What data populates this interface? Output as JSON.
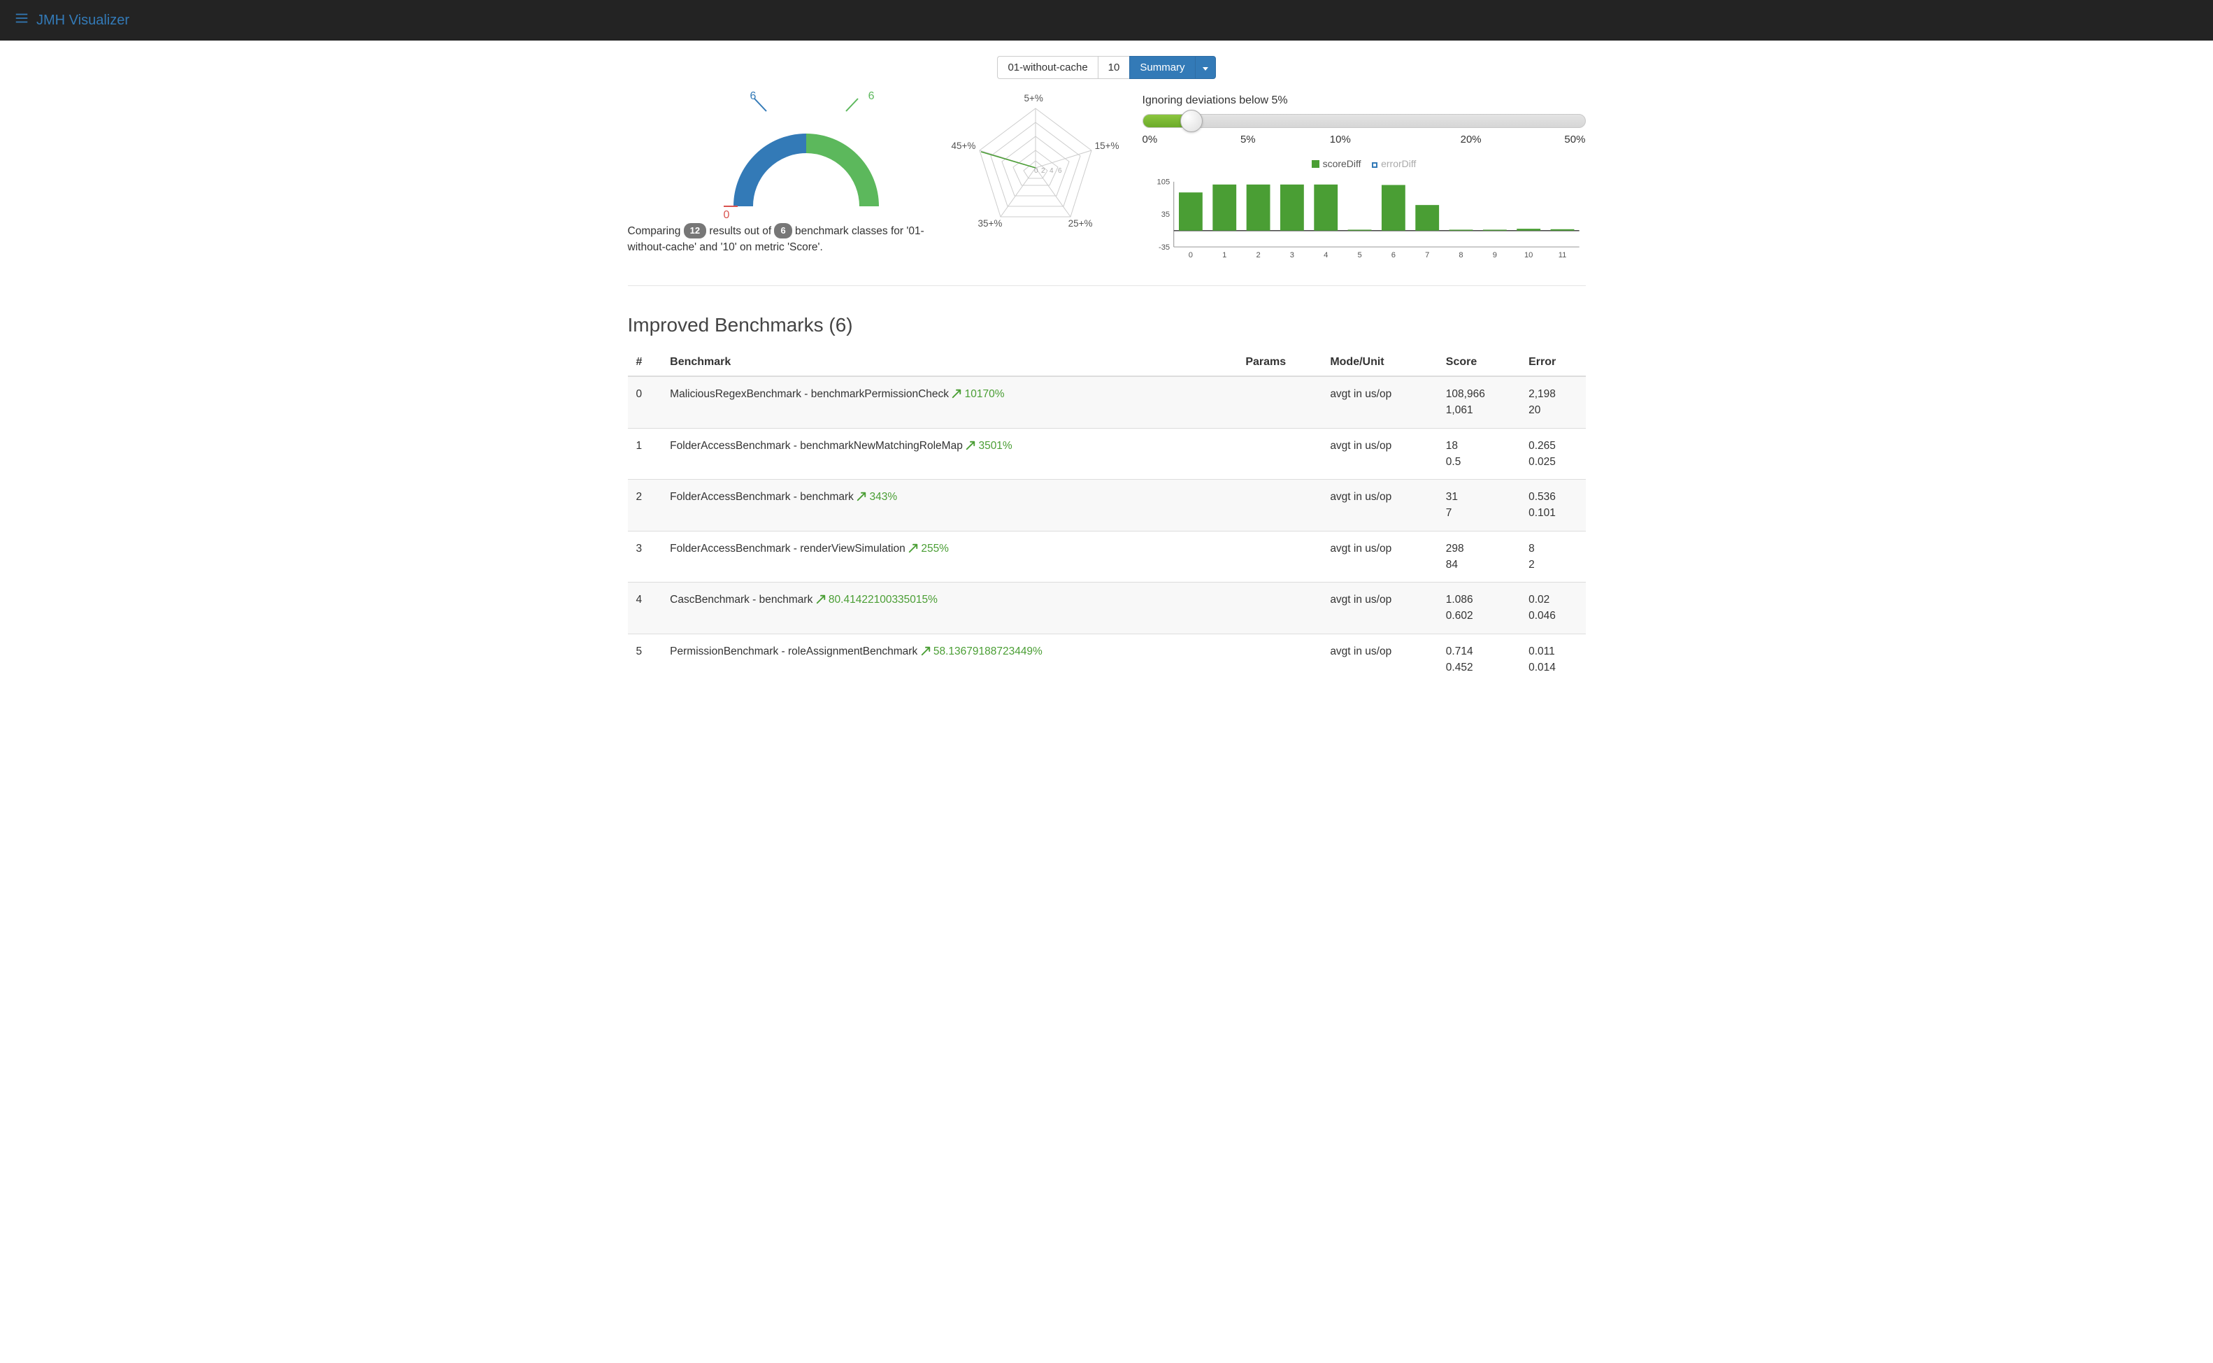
{
  "navbar": {
    "brand": "JMH Visualizer"
  },
  "controls": {
    "run1": "01-without-cache",
    "run2": "10",
    "summary_btn": "Summary"
  },
  "overview": {
    "gauge": {
      "worse": "0",
      "mid": "6",
      "better": "6"
    },
    "compare": {
      "pre": "Comparing ",
      "results": "12",
      "mid1": " results out of ",
      "classes": "6",
      "mid2": " benchmark classes for '01-without-cache' and '10' on metric 'Score'."
    },
    "radar_ticks": [
      "5+%",
      "15+%",
      "25+%",
      "35+%",
      "45+%"
    ]
  },
  "slider": {
    "label": "Ignoring deviations below 5%",
    "percent": 11,
    "ticks": [
      "0%",
      "5%",
      "10%",
      "20%",
      "50%"
    ]
  },
  "barchart": {
    "legend": {
      "scoreDiff": "scoreDiff",
      "errorDiff": "errorDiff"
    },
    "yticks": [
      "105",
      "35",
      "-35"
    ],
    "xticks": [
      "0",
      "1",
      "2",
      "3",
      "4",
      "5",
      "6",
      "7",
      "8",
      "9",
      "10",
      "11"
    ]
  },
  "chart_data": {
    "type": "bar",
    "title": "",
    "xlabel": "",
    "ylabel": "",
    "ylim": [
      -35,
      105
    ],
    "categories": [
      0,
      1,
      2,
      3,
      4,
      5,
      6,
      7,
      8,
      9,
      10,
      11
    ],
    "series": [
      {
        "name": "scoreDiff",
        "values": [
          82,
          99,
          99,
          99,
          99,
          2,
          98,
          55,
          2,
          2,
          4,
          3
        ]
      },
      {
        "name": "errorDiff",
        "values": [
          0,
          0,
          0,
          0,
          0,
          0,
          0,
          0,
          0,
          0,
          0,
          0
        ]
      }
    ]
  },
  "improved_section_title": "Improved Benchmarks (6)",
  "table": {
    "headers": {
      "idx": "#",
      "benchmark": "Benchmark",
      "params": "Params",
      "mode": "Mode/Unit",
      "score": "Score",
      "error": "Error"
    },
    "rows": [
      {
        "idx": "0",
        "name": "MaliciousRegexBenchmark - benchmarkPermissionCheck",
        "pct": "10170%",
        "mode": "avgt in us/op",
        "score1": "108,966",
        "score2": "1,061",
        "err1": "2,198",
        "err2": "20"
      },
      {
        "idx": "1",
        "name": "FolderAccessBenchmark - benchmarkNewMatchingRoleMap",
        "pct": "3501%",
        "mode": "avgt in us/op",
        "score1": "18",
        "score2": "0.5",
        "err1": "0.265",
        "err2": "0.025"
      },
      {
        "idx": "2",
        "name": "FolderAccessBenchmark - benchmark",
        "pct": "343%",
        "mode": "avgt in us/op",
        "score1": "31",
        "score2": "7",
        "err1": "0.536",
        "err2": "0.101"
      },
      {
        "idx": "3",
        "name": "FolderAccessBenchmark - renderViewSimulation",
        "pct": "255%",
        "mode": "avgt in us/op",
        "score1": "298",
        "score2": "84",
        "err1": "8",
        "err2": "2"
      },
      {
        "idx": "4",
        "name": "CascBenchmark - benchmark",
        "pct": "80.41422100335015%",
        "mode": "avgt in us/op",
        "score1": "1.086",
        "score2": "0.602",
        "err1": "0.02",
        "err2": "0.046"
      },
      {
        "idx": "5",
        "name": "PermissionBenchmark - roleAssignmentBenchmark",
        "pct": "58.13679188723449%",
        "mode": "avgt in us/op",
        "score1": "0.714",
        "score2": "0.452",
        "err1": "0.011",
        "err2": "0.014"
      }
    ]
  }
}
